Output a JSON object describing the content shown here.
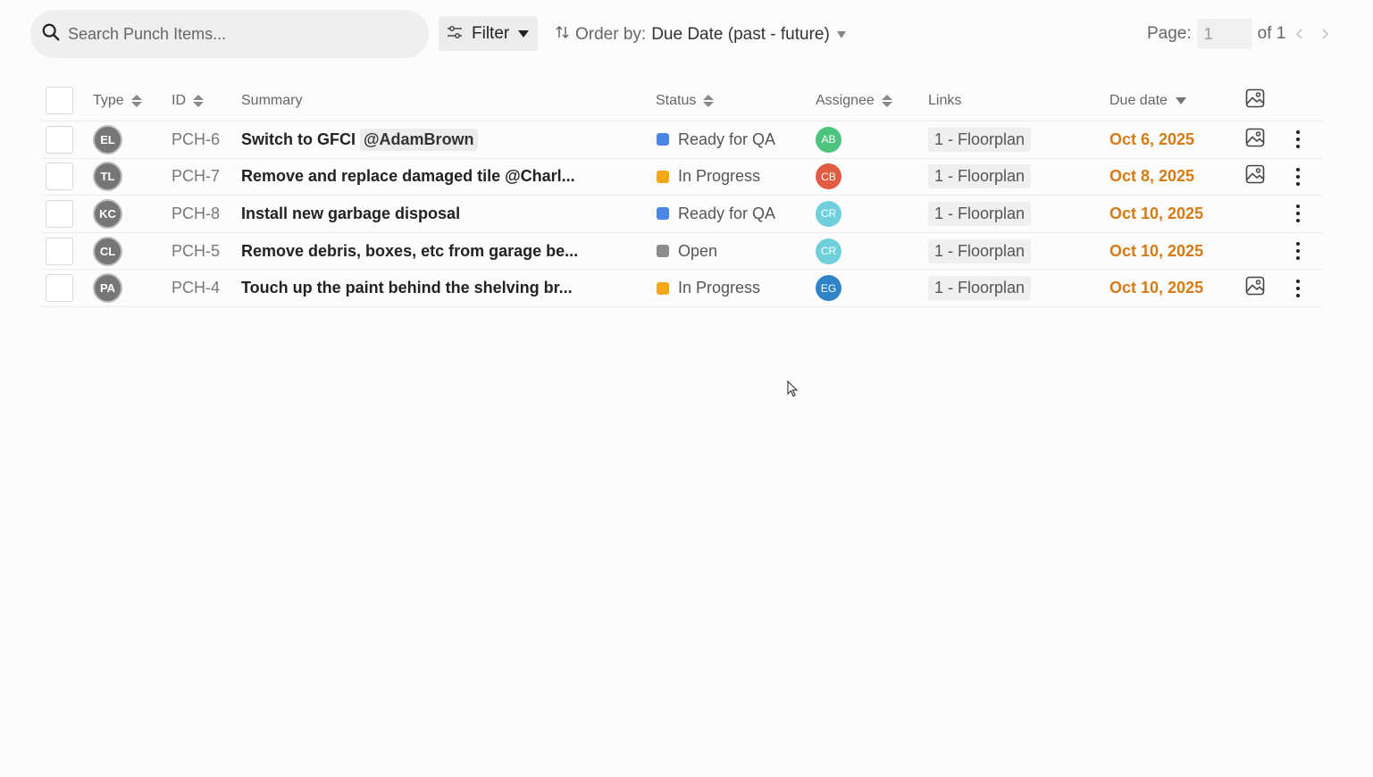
{
  "toolbar": {
    "search_placeholder": "Search Punch Items...",
    "filter_label": "Filter",
    "order_label": "Order by:",
    "order_value": "Due Date (past - future)",
    "page_label": "Page:",
    "page_value": "1",
    "page_of": "of 1"
  },
  "columns": {
    "type": "Type",
    "id": "ID",
    "summary": "Summary",
    "status": "Status",
    "assignee": "Assignee",
    "links": "Links",
    "due": "Due date"
  },
  "rows": [
    {
      "type": "EL",
      "id": "PCH-6",
      "summary": "Switch to GFCI",
      "mention": "@AdamBrown",
      "status": "Ready for QA",
      "status_color": "#4a86e8",
      "assignee": "AB",
      "assignee_color": "#4cc47e",
      "link": "1 - Floorplan",
      "due": "Oct 6, 2025",
      "has_image": true
    },
    {
      "type": "TL",
      "id": "PCH-7",
      "summary": "Remove and replace damaged tile @Charl...",
      "mention": "",
      "status": "In Progress",
      "status_color": "#f2a818",
      "assignee": "CB",
      "assignee_color": "#e15a42",
      "link": "1 - Floorplan",
      "due": "Oct 8, 2025",
      "has_image": true
    },
    {
      "type": "KC",
      "id": "PCH-8",
      "summary": "Install new garbage disposal",
      "mention": "",
      "status": "Ready for QA",
      "status_color": "#4a86e8",
      "assignee": "CR",
      "assignee_color": "#6fd0dc",
      "link": "1 - Floorplan",
      "due": "Oct 10, 2025",
      "has_image": false
    },
    {
      "type": "CL",
      "id": "PCH-5",
      "summary": "Remove debris, boxes, etc from garage be...",
      "mention": "",
      "status": "Open",
      "status_color": "#8c8c8c",
      "assignee": "CR",
      "assignee_color": "#6fd0dc",
      "link": "1 - Floorplan",
      "due": "Oct 10, 2025",
      "has_image": false
    },
    {
      "type": "PA",
      "id": "PCH-4",
      "summary": "Touch up the paint behind the shelving br...",
      "mention": "",
      "status": "In Progress",
      "status_color": "#f2a818",
      "assignee": "EG",
      "assignee_color": "#2f84c8",
      "link": "1 - Floorplan",
      "due": "Oct 10, 2025",
      "has_image": true
    }
  ]
}
